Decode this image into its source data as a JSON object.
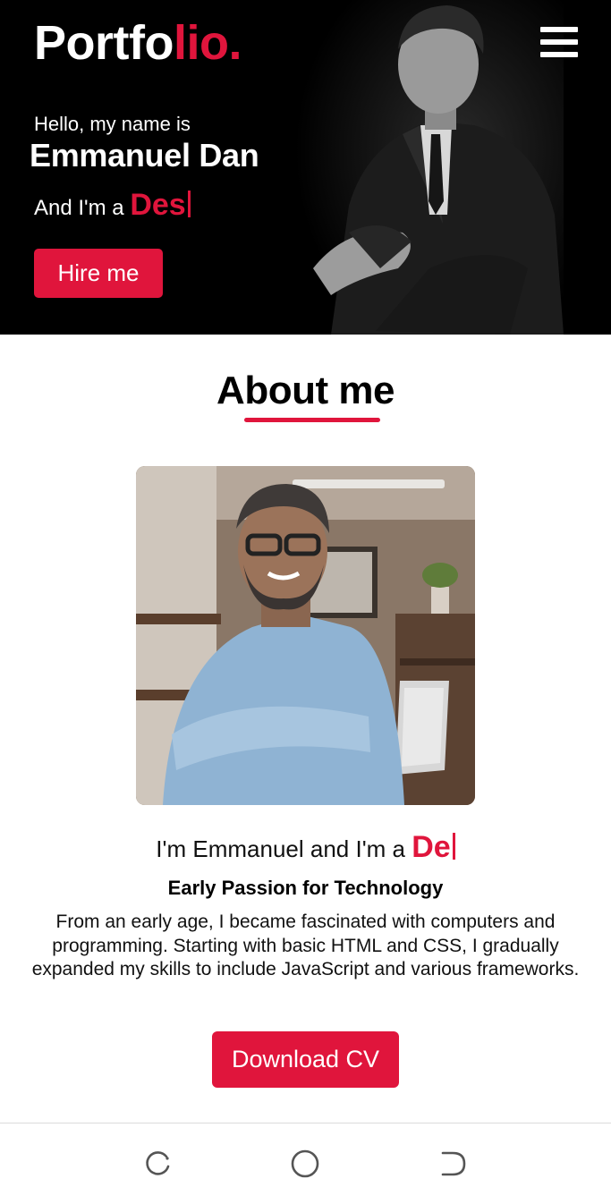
{
  "hero": {
    "logo_main": "Portfo",
    "logo_accent": "lio.",
    "greeting": "Hello, my name is",
    "name": "Emmanuel Dan",
    "role_prefix": "And I'm a",
    "role_typed": "Des",
    "hire_label": "Hire me"
  },
  "about": {
    "title": "About me",
    "intro_prefix": "I'm Emmanuel and I'm a",
    "intro_typed": "De",
    "subheading": "Early Passion for Technology",
    "paragraph": "From an early age, I became fascinated with computers and programming. Starting with basic HTML and CSS, I gradually expanded my skills to include JavaScript and various frameworks.",
    "download_label": "Download CV"
  },
  "navbar": {
    "icons": [
      "recent-apps-icon",
      "home-icon",
      "back-icon"
    ]
  },
  "colors": {
    "accent": "#e0153c",
    "hero_bg": "#000000",
    "page_bg": "#ffffff"
  }
}
